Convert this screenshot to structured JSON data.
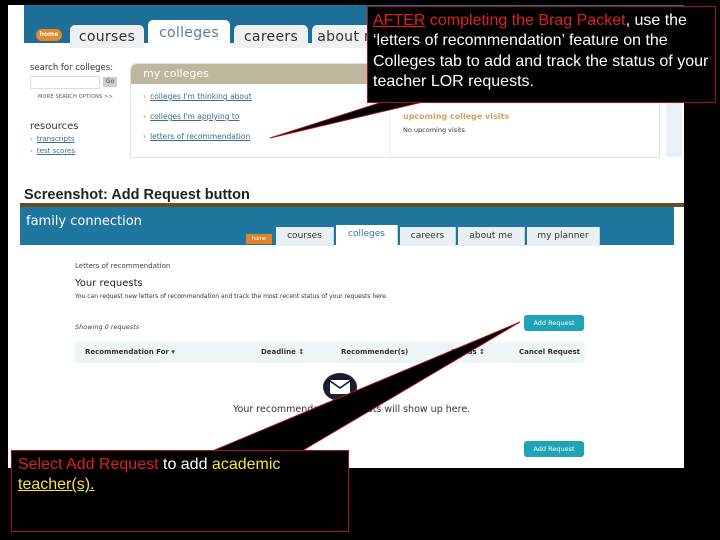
{
  "top_screenshot": {
    "home_label": "home",
    "tabs": [
      {
        "label": "courses",
        "active": false
      },
      {
        "label": "colleges",
        "active": true
      },
      {
        "label": "careers",
        "active": false
      },
      {
        "label": "about me",
        "active": false
      }
    ],
    "search": {
      "label": "search for colleges:",
      "value": "",
      "go_label": "Go",
      "more_options": "MORE SEARCH OPTIONS >>"
    },
    "resources": {
      "title": "resources",
      "links": [
        "transcripts",
        "test scores"
      ]
    },
    "my_colleges": {
      "title": "my colleges",
      "links": [
        "colleges I'm thinking about",
        "colleges I'm applying to",
        "letters of recommendation"
      ]
    },
    "upcoming_visits": {
      "title": "upcoming college visits",
      "text": "No upcoming visits."
    }
  },
  "section_caption": "Screenshot:  Add Request button",
  "new_screenshot": {
    "app_title": "family connection",
    "home_label": "home",
    "tabs": [
      {
        "label": "courses",
        "active": false
      },
      {
        "label": "colleges",
        "active": true
      },
      {
        "label": "careers",
        "active": false
      },
      {
        "label": "about me",
        "active": false
      },
      {
        "label": "my planner",
        "active": false
      }
    ],
    "breadcrumb": "Letters of recommendation",
    "page_title": "Your requests",
    "description": "You can request new letters of recommendation and track the most recent status of your requests here.",
    "showing": "Showing 0 requests",
    "add_request_label": "Add Request",
    "table_headers": [
      "Recommendation For ▾",
      "Deadline ↕",
      "Recommender(s)",
      "Status ↕",
      "Cancel Request"
    ],
    "empty_icon": "envelope-icon",
    "empty_text": "Your recommendation requests will show up here."
  },
  "callouts": {
    "top": {
      "part1_underlined": "AFTER",
      "part2_red": " completing the Brag Packet",
      "part3": ", use the ‘letters of recommendation’ feature on the Colleges tab to add and track the status of your teacher LOR requests."
    },
    "bottom": {
      "part1_red": "Select Add Request",
      "part2": " to add ",
      "part3_yellow": "academic",
      "part4_yellow_underlined": "teacher(s)."
    }
  },
  "colors": {
    "header_blue": "#1f77a0",
    "callout_border": "#a1141c",
    "highlight_red": "#e02020",
    "highlight_yellow": "#f5e830",
    "button_teal": "#1ea4b5",
    "home_orange": "#e0832b"
  }
}
